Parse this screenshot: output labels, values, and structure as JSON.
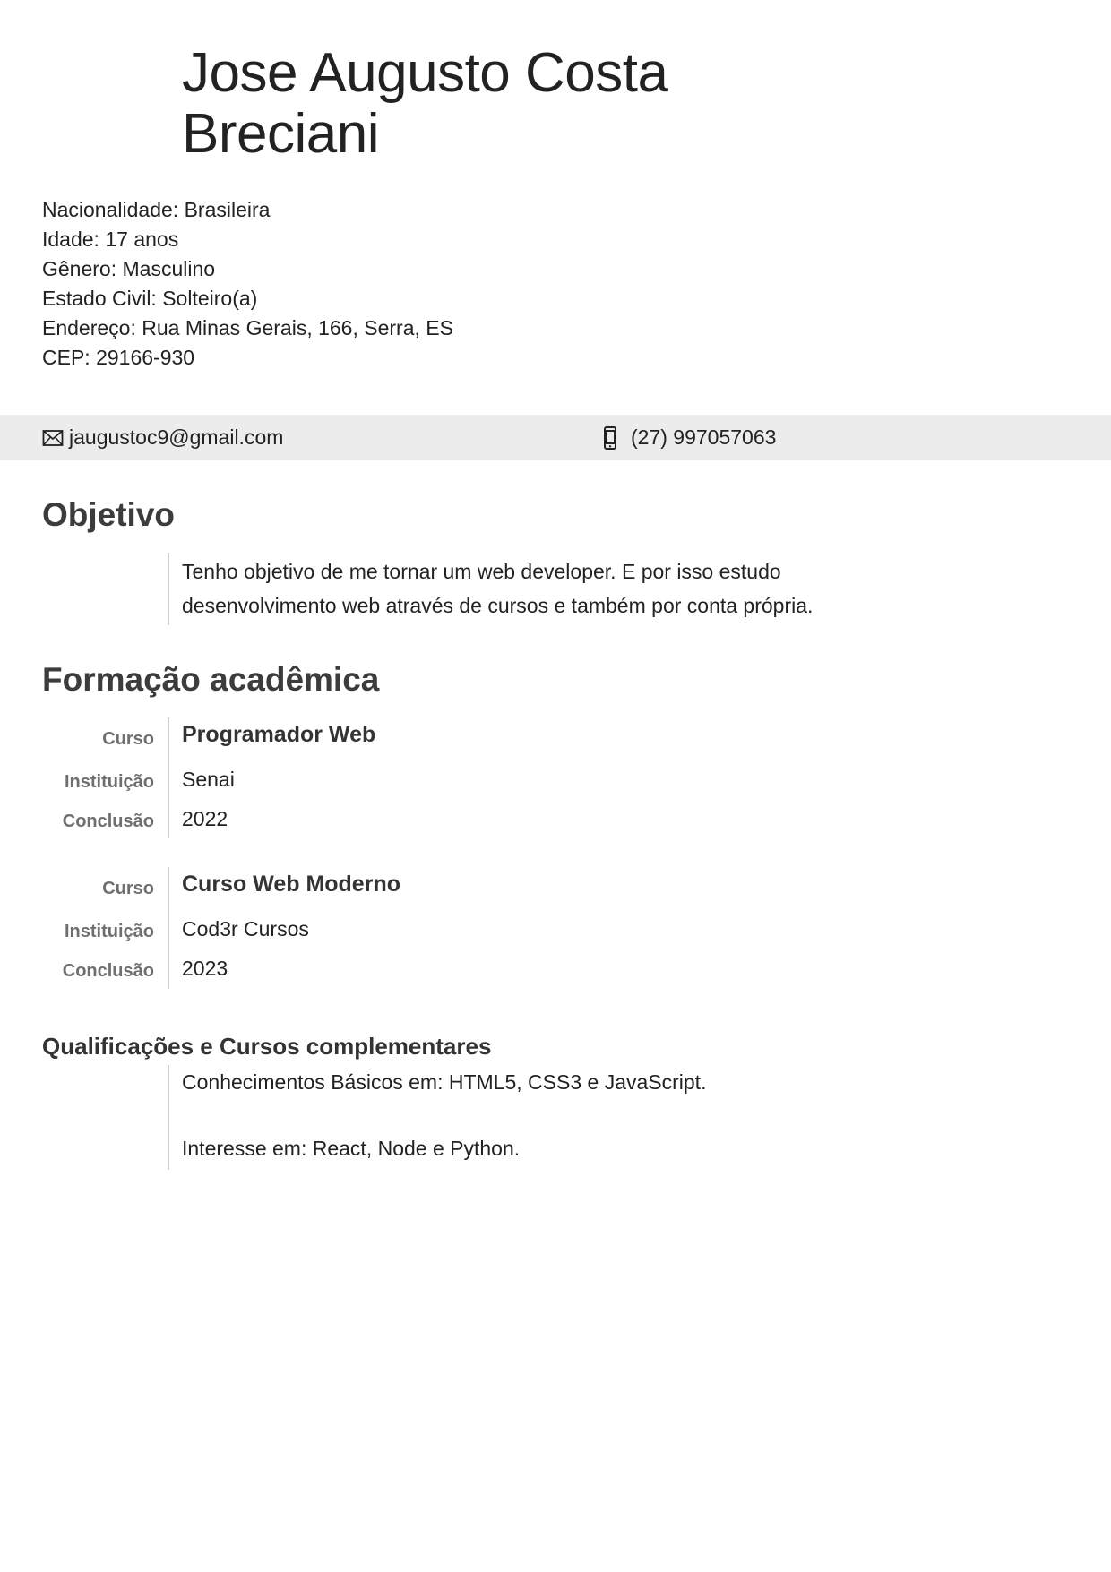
{
  "header": {
    "name_line1": "Jose Augusto Costa",
    "name_line2": "Breciani"
  },
  "personal": [
    {
      "label": "Nacionalidade:",
      "value": "Brasileira"
    },
    {
      "label": "Idade:",
      "value": "17 anos"
    },
    {
      "label": "Gênero:",
      "value": "Masculino"
    },
    {
      "label": "Estado Civil:",
      "value": "Solteiro(a)"
    },
    {
      "label": "Endereço:",
      "value": "Rua Minas Gerais, 166, Serra, ES"
    },
    {
      "label": "CEP:",
      "value": "29166-930"
    }
  ],
  "contact": {
    "email": "jaugustoc9@gmail.com",
    "email_icon": "envelope-icon",
    "phone": "(27) 997057063",
    "phone_icon": "mobile-phone-icon"
  },
  "objective": {
    "title": "Objetivo",
    "text": "Tenho objetivo de me tornar um web developer. E por isso estudo desenvolvimento web através de cursos e também por conta própria."
  },
  "education": {
    "title": "Formação acadêmica",
    "entries": [
      {
        "course_label": "Curso",
        "course": "Programador Web",
        "institution_label": "Instituição",
        "institution": "Senai",
        "completion_label": "Conclusão",
        "completion": "2022"
      },
      {
        "course_label": "Curso",
        "course": "Curso Web Moderno",
        "institution_label": "Instituição",
        "institution": "Cod3r Cursos",
        "completion_label": "Conclusão",
        "completion": "2023"
      }
    ]
  },
  "qualifications": {
    "title": "Qualificações e Cursos complementares",
    "line1": "Conhecimentos Básicos em: HTML5, CSS3 e JavaScript.",
    "line2": "Interesse em: React, Node e Python."
  }
}
